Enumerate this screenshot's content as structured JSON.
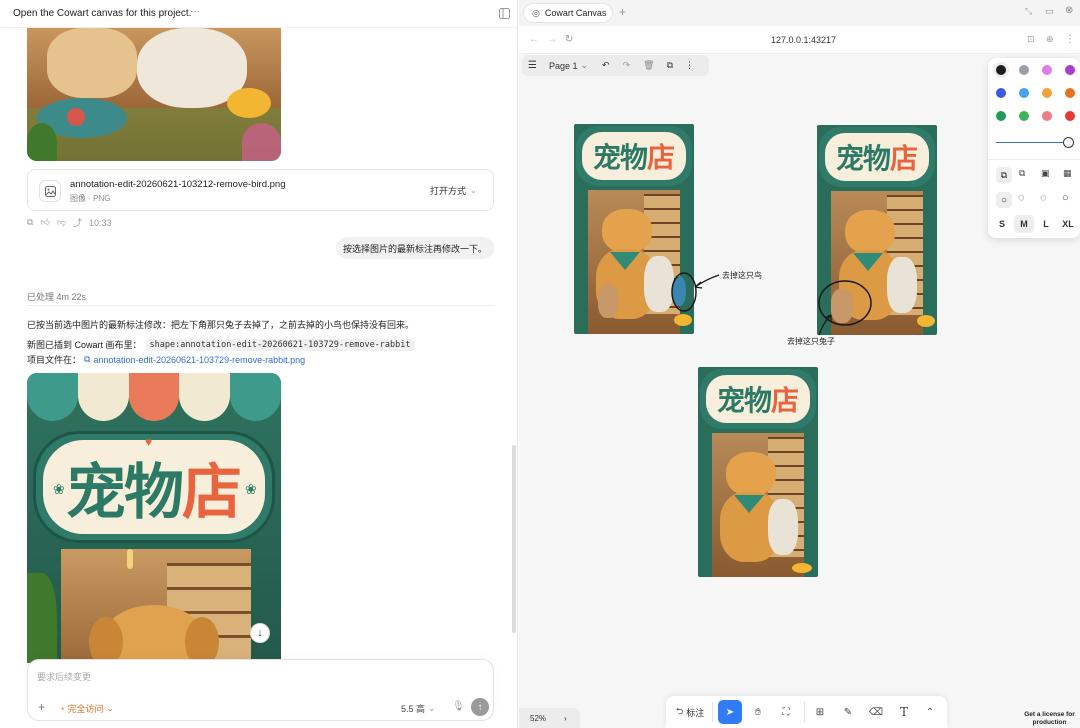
{
  "left": {
    "header_title": "Open the Cowart canvas for this project.",
    "header_more": "···",
    "attachment": {
      "filename": "annotation-edit-20260621-103212-remove-bird.png",
      "meta": "图像 · PNG",
      "open_with": "打开方式"
    },
    "msg_time": "10:33",
    "user_message": "按选择图片的最新标注再修改一下。",
    "processed": "已处理 4m 22s",
    "reply_line1": "已按当前选中图片的最新标注修改：把左下角那只兔子去掉了，之前去掉的小鸟也保持没有回来。",
    "reply_line2_prefix": "新图已插到 Cowart 画布里：",
    "reply_line2_code": "shape:annotation-edit-20260621-103729-remove-rabbit",
    "reply_line3_prefix": "项目文件在：",
    "reply_line3_link": "annotation-edit-20260621-103729-remove-rabbit.png",
    "poster_title_a": "宠物",
    "poster_title_b": "店",
    "composer_placeholder": "要求后续变更",
    "access_label": "完全访问",
    "model_label": "5.5 高"
  },
  "right": {
    "tab_label": "Cowart Canvas",
    "url": "127.0.0.1:43217",
    "page_label": "Page 1",
    "poster_title_a": "宠物",
    "poster_title_b": "店",
    "annotation_bird": "去掉这只鸟",
    "annotation_rabbit": "去掉这只兔子",
    "sizes": [
      "S",
      "M",
      "L",
      "XL"
    ],
    "toolbar_annotate": "标注",
    "zoom": "52%",
    "license_line1": "Get a license for",
    "license_line2": "production",
    "colors": [
      "#1d1d1d",
      "#9aa0a6",
      "#e07de8",
      "#a63ed0",
      "#3b5bdb",
      "#4ba3f0",
      "#f0a23a",
      "#e8711f",
      "#1f9a57",
      "#3fb35a",
      "#ef7c84",
      "#e53935"
    ],
    "accent": "#2f7cf6"
  }
}
